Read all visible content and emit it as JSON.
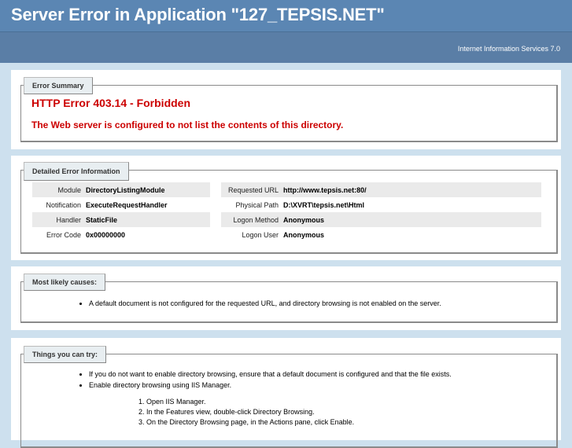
{
  "header": {
    "title": "Server Error in Application \"127_TEPSIS.NET\"",
    "subtitle": "Internet Information Services 7.0"
  },
  "summary": {
    "legend": "Error Summary",
    "error_title": "HTTP Error 403.14 - Forbidden",
    "message": "The Web server is configured to not list the contents of this directory."
  },
  "details": {
    "legend": "Detailed Error Information",
    "left": [
      {
        "k": "Module",
        "v": "DirectoryListingModule"
      },
      {
        "k": "Notification",
        "v": "ExecuteRequestHandler"
      },
      {
        "k": "Handler",
        "v": "StaticFile"
      },
      {
        "k": "Error Code",
        "v": "0x00000000"
      }
    ],
    "right": [
      {
        "k": "Requested URL",
        "v": "http://www.tepsis.net:80/"
      },
      {
        "k": "Physical Path",
        "v": "D:\\XVRT\\tepsis.net\\Html"
      },
      {
        "k": "Logon Method",
        "v": "Anonymous"
      },
      {
        "k": "Logon User",
        "v": "Anonymous"
      }
    ]
  },
  "causes": {
    "legend": "Most likely causes:",
    "items": [
      "A default document is not configured for the requested URL, and directory browsing is not enabled on the server."
    ]
  },
  "try": {
    "legend": "Things you can try:",
    "items": [
      "If you do not want to enable directory browsing, ensure that a default document is configured and that the file exists.",
      "Enable directory browsing using IIS Manager."
    ],
    "steps": [
      "Open IIS Manager.",
      "In the Features view, double-click Directory Browsing.",
      "On the Directory Browsing page, in the Actions pane, click Enable."
    ]
  }
}
